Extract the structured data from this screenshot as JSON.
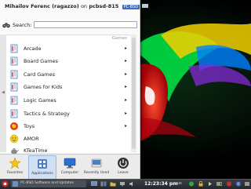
{
  "menu": {
    "user": "Mihailov Ferenc (ragazzo)",
    "on_text": "on",
    "host": "pcbsd-815",
    "badge": "PC-BSD",
    "search_label": "Search:",
    "search_value": "",
    "section_label": "Games",
    "items": [
      {
        "label": "Arcade",
        "icon": "book-icon",
        "has_submenu": true
      },
      {
        "label": "Board Games",
        "icon": "book-icon",
        "has_submenu": true
      },
      {
        "label": "Card Games",
        "icon": "book-icon",
        "has_submenu": true
      },
      {
        "label": "Games for Kids",
        "icon": "book-icon",
        "has_submenu": true
      },
      {
        "label": "Logic Games",
        "icon": "book-icon",
        "has_submenu": true
      },
      {
        "label": "Tactics & Strategy",
        "icon": "book-icon",
        "has_submenu": true
      },
      {
        "label": "Toys",
        "icon": "toy-icon",
        "has_submenu": true
      },
      {
        "label": "AMOR",
        "icon": "smiley-icon",
        "has_submenu": false
      },
      {
        "label": "KTeaTime",
        "icon": "teapot-icon",
        "has_submenu": false
      }
    ],
    "tabs": [
      {
        "label": "Favorites",
        "icon": "star-icon",
        "active": false
      },
      {
        "label": "Applications",
        "icon": "applications-icon",
        "active": true
      },
      {
        "label": "Computer",
        "icon": "computer-icon",
        "active": false
      },
      {
        "label": "Recently Used",
        "icon": "clock-icon",
        "active": false
      },
      {
        "label": "Leave",
        "icon": "power-icon",
        "active": false
      }
    ]
  },
  "taskbar": {
    "task_title": "PC-BSD Software and Updates",
    "clock": "12:23:34 pm",
    "keyboard_layout": "us"
  },
  "colors": {
    "accent": "#3d6fb8",
    "wallpaper": "#000000",
    "flame_red": "#e0101a",
    "flame_green": "#1a8a2e"
  }
}
